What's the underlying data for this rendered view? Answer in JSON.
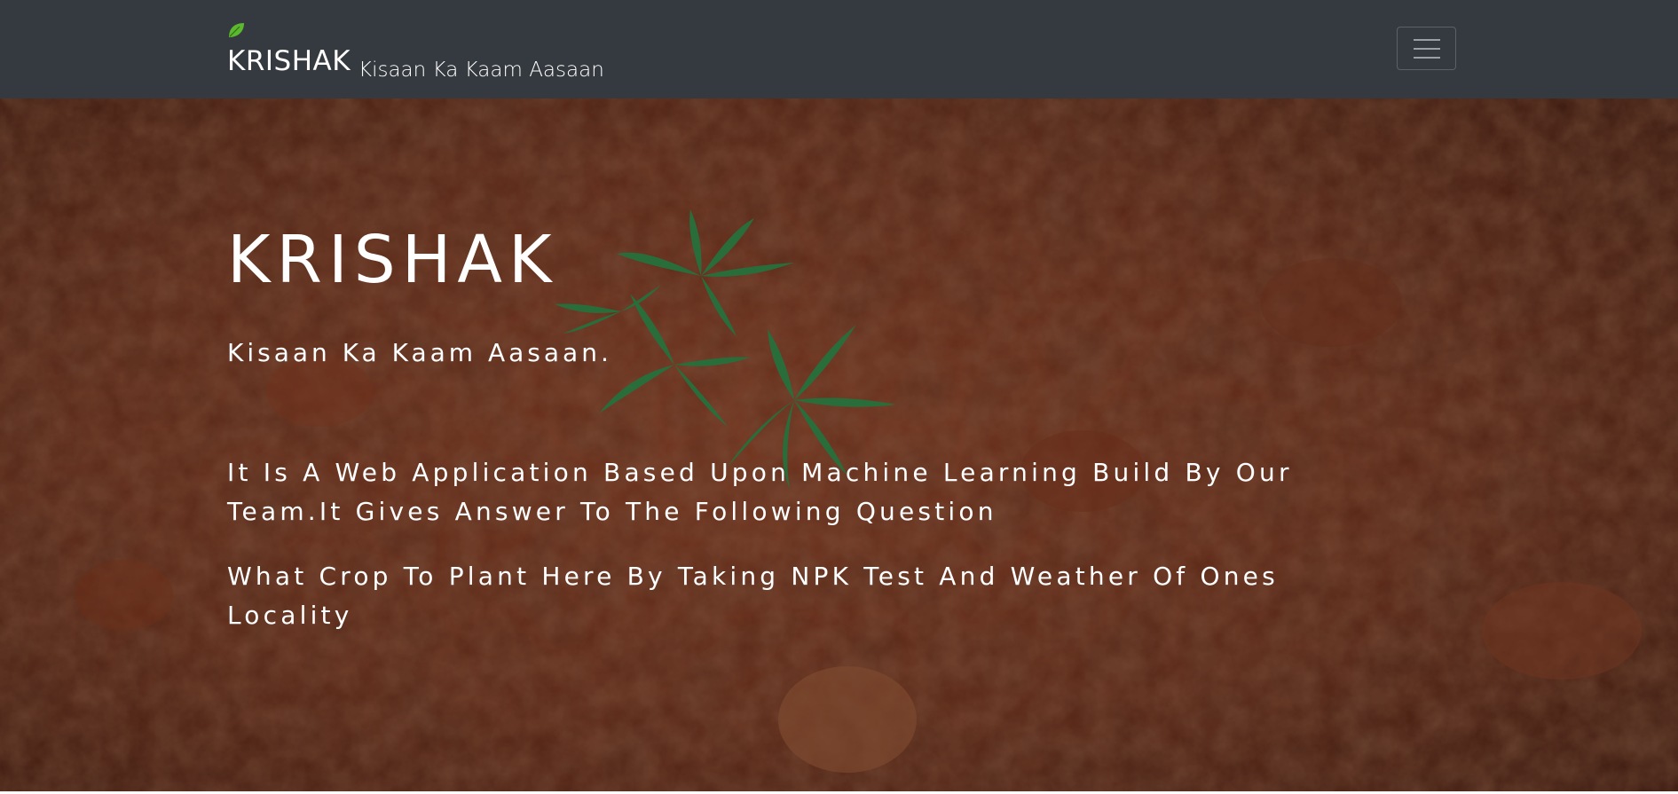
{
  "navbar": {
    "brand_name": "KRISHAK",
    "brand_tagline": "Kisaan Ka Kaam Aasaan",
    "toggler_icon": "hamburger-menu-icon",
    "logo_icon": "leaf-icon",
    "background_color": "#343a40"
  },
  "hero": {
    "title": "KRISHAK",
    "subtitle": "Kisaan Ka Kaam Aasaan.",
    "paragraph_1": "It Is A Web Application Based Upon Machine Learning Build By Our Team.It Gives Answer To The Following Question",
    "paragraph_2": "What Crop To Plant Here By Taking NPK Test And Weather Of Ones Locality",
    "background_image": "soil-with-seedling-photo",
    "soil_color": "#7a3520"
  }
}
